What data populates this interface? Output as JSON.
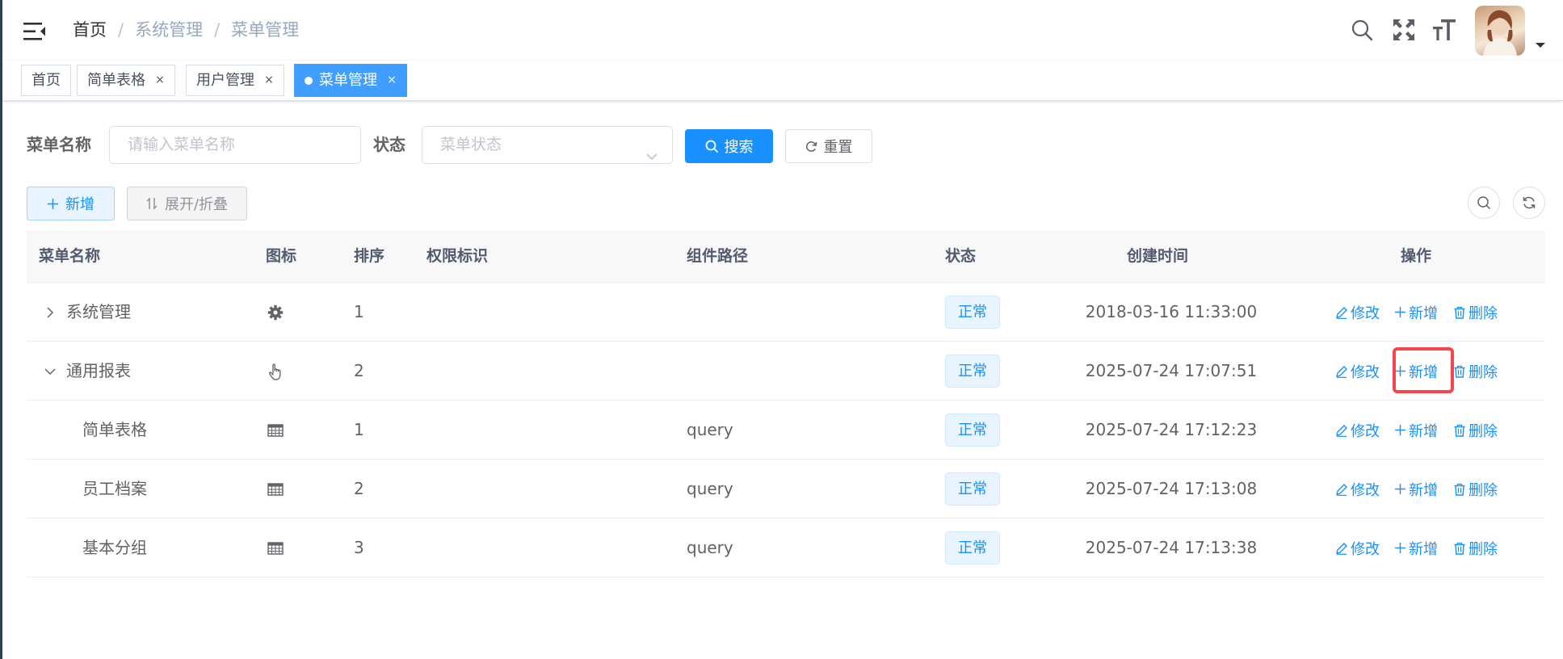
{
  "navbar": {
    "breadcrumb": [
      "首页",
      "系统管理",
      "菜单管理"
    ],
    "breadcrumb_separator": "/",
    "icons": [
      "search-icon",
      "fullscreen-icon",
      "text-size-icon"
    ]
  },
  "tags": [
    {
      "label": "首页",
      "closable": false,
      "active": false
    },
    {
      "label": "简单表格",
      "closable": true,
      "active": false
    },
    {
      "label": "用户管理",
      "closable": true,
      "active": false
    },
    {
      "label": "菜单管理",
      "closable": true,
      "active": true
    }
  ],
  "tag_close_glyph": "×",
  "search_form": {
    "menu_name_label": "菜单名称",
    "menu_name_placeholder": "请输入菜单名称",
    "status_label": "状态",
    "status_placeholder": "菜单状态",
    "search_button": "搜索",
    "reset_button": "重置"
  },
  "toolbar": {
    "add_button": "新增",
    "toggle_expand_button": "展开/折叠"
  },
  "table": {
    "columns": [
      "菜单名称",
      "图标",
      "排序",
      "权限标识",
      "组件路径",
      "状态",
      "创建时间",
      "操作"
    ],
    "rows": [
      {
        "name": "系统管理",
        "level": 0,
        "expand": "collapsed",
        "icon": "gear-icon",
        "order": "1",
        "perms": "",
        "component": "",
        "status": "正常",
        "created": "2018-03-16 11:33:00"
      },
      {
        "name": "通用报表",
        "level": 0,
        "expand": "expanded",
        "icon": "pointer-hand-icon",
        "order": "2",
        "perms": "",
        "component": "",
        "status": "正常",
        "created": "2025-07-24 17:07:51"
      },
      {
        "name": "简单表格",
        "level": 1,
        "expand": "none",
        "icon": "table-icon",
        "order": "1",
        "perms": "",
        "component": "query",
        "status": "正常",
        "created": "2025-07-24 17:12:23"
      },
      {
        "name": "员工档案",
        "level": 1,
        "expand": "none",
        "icon": "table-icon",
        "order": "2",
        "perms": "",
        "component": "query",
        "status": "正常",
        "created": "2025-07-24 17:13:08"
      },
      {
        "name": "基本分组",
        "level": 1,
        "expand": "none",
        "icon": "table-icon",
        "order": "3",
        "perms": "",
        "component": "query",
        "status": "正常",
        "created": "2025-07-24 17:13:38"
      }
    ],
    "actions": {
      "edit": "修改",
      "add": "新增",
      "delete": "删除"
    }
  },
  "colors": {
    "primary": "#1890ff",
    "active_tag": "#409eff",
    "highlight_box": "#f4454d",
    "header_bg": "#f8f8f9"
  }
}
